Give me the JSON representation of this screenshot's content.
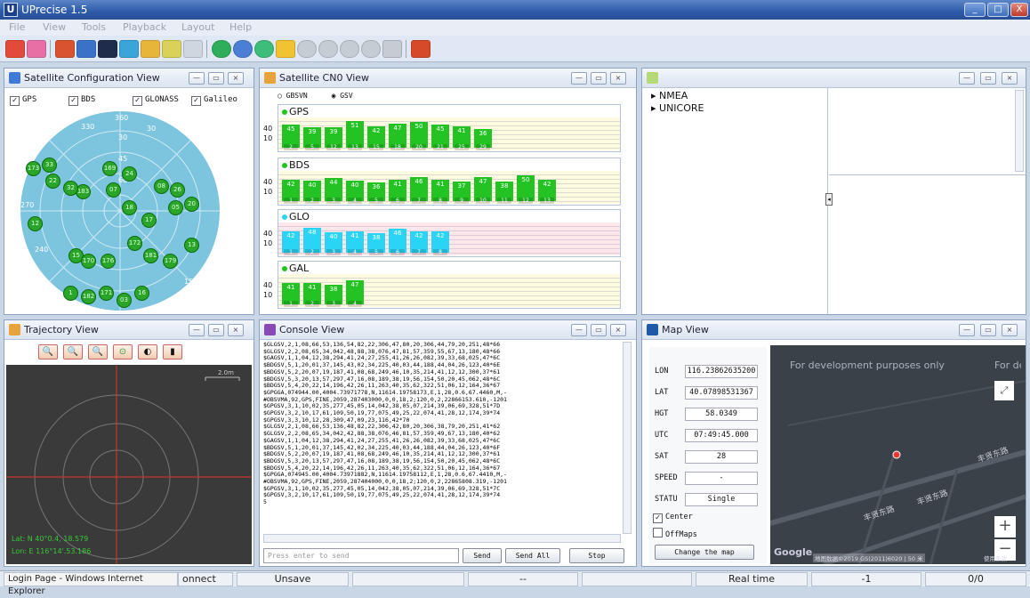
{
  "window": {
    "title": "UPrecise 1.5",
    "app_icon": "U",
    "min": "_",
    "max": "□",
    "close": "X"
  },
  "menu": [
    "File",
    "View",
    "Tools",
    "Playback",
    "Layout",
    "Help"
  ],
  "toolbar_icons": [
    "connect-icon",
    "port-icon",
    "satellite-config-icon",
    "satellite-view-icon",
    "cn0-chart-icon",
    "constellation-icon",
    "log-icon",
    "settings-icon",
    "record-icon",
    "globe-icon",
    "refresh-icon",
    "open-folder-icon",
    "play-icon",
    "pause-icon",
    "stop-icon",
    "step-icon",
    "forward-icon",
    "tools-icon"
  ],
  "satconfig": {
    "title": "Satellite Configuration View",
    "checks": [
      {
        "label": "GPS",
        "checked": true
      },
      {
        "label": "BDS",
        "checked": true
      },
      {
        "label": "GLONASS",
        "checked": true
      },
      {
        "label": "Galileo",
        "checked": true
      }
    ],
    "rings": [
      "0",
      "30",
      "45",
      "60"
    ],
    "azimuth": [
      "360",
      "30",
      "60",
      "90",
      "120",
      "150",
      "240",
      "270",
      "330"
    ],
    "sats": [
      "173",
      "33",
      "22",
      "169",
      "24",
      "07",
      "08",
      "26",
      "183",
      "32",
      "18",
      "17",
      "05",
      "20",
      "12",
      "172",
      "13",
      "181",
      "179",
      "15",
      "170",
      "176",
      "182",
      "171",
      "03",
      "16",
      "1"
    ]
  },
  "cn0": {
    "title": "Satellite CN0 View",
    "radios": [
      {
        "label": "GBSVN",
        "selected": false
      },
      {
        "label": "GSV",
        "selected": true
      }
    ],
    "axis": [
      "40",
      "10"
    ],
    "groups": [
      {
        "label": "GPS",
        "color": "#22c322",
        "ids": [
          "2",
          "5",
          "12",
          "13",
          "15",
          "18",
          "20",
          "21",
          "25",
          "29"
        ],
        "values": [
          45,
          39,
          39,
          51,
          42,
          47,
          50,
          45,
          41,
          36
        ]
      },
      {
        "label": "BDS",
        "color": "#22c322",
        "ids": [
          "1",
          "2",
          "3",
          "4",
          "5",
          "6",
          "7",
          "8",
          "9",
          "10",
          "11",
          "12",
          "13"
        ],
        "values": [
          42,
          40,
          44,
          40,
          36,
          41,
          46,
          41,
          37,
          47,
          38,
          50,
          42
        ]
      },
      {
        "label": "GLO",
        "color": "#2ad4f4",
        "ids": [
          "1",
          "2",
          "3",
          "4",
          "5",
          "6",
          "7",
          "8"
        ],
        "values": [
          42,
          48,
          40,
          41,
          38,
          46,
          42,
          42
        ]
      },
      {
        "label": "GAL",
        "color": "#22c322",
        "ids": [
          "1",
          "2",
          "3",
          "4"
        ],
        "values": [
          41,
          41,
          38,
          47
        ]
      }
    ]
  },
  "nmea": {
    "tree": [
      "NMEA",
      "UNICORE"
    ]
  },
  "trajectory": {
    "title": "Trajectory View",
    "scale": "2.0m",
    "lat": "Lat: N 40°0.4, 18.579",
    "lon": "Lon: E 116°14'.53.186"
  },
  "console": {
    "title": "Console View",
    "lines": [
      "$GLGSV,2,1,08,66,53,136,54,82,22,306,47,80,20,306,44,79,20,251,48*66",
      "$GLGSV,2,2,08,65,34,042,48,88,38,076,47,81,57,359,55,67,13,180,48*66",
      "$GAGSV,1,1,04,12,38,294,41,24,27,255,41,26,26,082,39,33,68,025,47*6C",
      "$BDGSV,5,1,20,01,37,145,43,02,34,225,40,03,44,188,44,04,26,123,40*6E",
      "$BDGSV,5,2,20,07,19,187,41,08,68,249,46,10,35,214,41,12,12,300,37*61",
      "$BDGSV,5,3,20,13,57,297,47,16,08,189,38,19,56,154,50,20,45,062,48*6C",
      "$BDGSV,5,4,20,22,14,196,42,26,11,263,40,35,62,322,51,06,12,164,36*67",
      "$GPGGA,074944.00,4004.73971778,N,11614.19758173,E,1,28,0.6,67.4460,M,-",
      "#OBSVMA,92,GPS,FINE,2059,287403000,0,0,18,2;120,0,2,22866153.610,-1201",
      "$GPGSV,3,1,10,02,35,277,45,05,14,042,38,05,07,214,39,06,69,328,51*7D",
      "$GPGSV,3,2,10,17,61,109,50,19,77,075,49,25,22,074,41,28,12,174,39*74",
      "$GPGSV,3,3,10,12,28,309,47,09,23,116,42*70",
      "$GLGSV,2,1,08,66,53,136,48,82,22,306,42,80,20,306,38,79,20,251,41*62",
      "$GLGSV,2,2,08,65,34,042,42,88,38,076,46,81,57,359,49,67,13,180,40*62",
      "$GAGSV,1,1,04,12,38,294,41,24,27,255,41,26,26,082,39,33,68,025,47*6C",
      "$BDGSV,5,1,20,01,37,145,42,02,34,225,40,03,44,188,44,04,26,123,40*6F",
      "$BDGSV,5,2,20,07,19,187,41,08,68,249,46,10,35,214,41,12,12,300,37*61",
      "$BDGSV,5,3,20,13,57,297,47,16,08,189,38,19,56,154,50,20,45,062,48*6C",
      "$BDGSV,5,4,20,22,14,196,42,26,11,263,40,35,62,322,51,06,12,164,36*67",
      "$GPGGA,074945.00,4004.73971882,N,11614.19758112,E,1,28,0.6,67.4410,M,-",
      "#OBSVMA,92,GPS,FINE,2059,287404000,0,0,18,2;120,0,2,22865808.319,-1201",
      "$GPGSV,3,1,10,02,35,277,45,05,14,042,38,05,07,214,39,06,69,328,51*7C",
      "$GPGSV,3,2,10,17,61,109,50,19,77,075,49,25,22,074,41,28,12,174,39*74",
      "5"
    ],
    "input_placeholder": "Press enter to send",
    "send": "Send",
    "send_all": "Send All",
    "stop": "Stop"
  },
  "map": {
    "title": "Map View",
    "fields": [
      {
        "label": "LON",
        "value": "116.23862635200"
      },
      {
        "label": "LAT",
        "value": "40.07898531367"
      },
      {
        "label": "HGT",
        "value": "58.0349"
      },
      {
        "label": "UTC",
        "value": "07:49:45.000"
      },
      {
        "label": "SAT",
        "value": "28"
      },
      {
        "label": "SPEED",
        "value": "-"
      },
      {
        "label": "STATU",
        "value": "Single"
      }
    ],
    "center": {
      "label": "Center",
      "checked": true
    },
    "offmaps": {
      "label": "OffMaps",
      "checked": false
    },
    "change_btn": "Change the map",
    "watermark": "For development purposes only",
    "watermark2": "For development purposes only",
    "zoom_in": "+",
    "zoom_out": "−",
    "road1": "丰贤东路",
    "road2": "丰贤东路",
    "road3": "丰贤东路",
    "google": "Google",
    "attribution": "地图数据©2019 GS(2011)6020 | 50 米",
    "terms": "使用条款",
    "marker_color": "#e53935"
  },
  "status": {
    "ie_title": "Login Page - Windows Internet Explorer",
    "connect": "onnect",
    "unsave": "Unsave",
    "dash": "--",
    "realtime": "Real time",
    "minus1": "-1",
    "ratio": "0/0"
  }
}
